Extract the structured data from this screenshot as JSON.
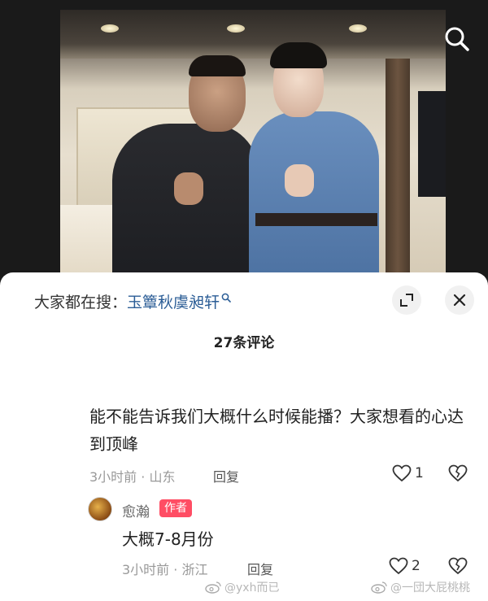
{
  "header": {
    "search_icon": "search-icon"
  },
  "photo": {
    "description_icon": "photo"
  },
  "hot_search": {
    "label": "大家都在搜：",
    "topic": "玉簟秋虞昶轩",
    "icon": "search-small-icon"
  },
  "controls": {
    "expand_icon": "expand-icon",
    "close_icon": "close-icon"
  },
  "comments_header": {
    "count_label": "27条评论"
  },
  "comment": {
    "text": "能不能告诉我们大概什么时候能播？大家想看的心达到顶峰",
    "time_location": "3小时前 · 山东",
    "reply_label": "回复",
    "likes": "1"
  },
  "reply": {
    "author": "愈瀚",
    "badge": "作者",
    "text": "大概7-8月份",
    "time_location": "3小时前 · 浙江",
    "reply_label": "回复",
    "likes": "2"
  },
  "watermarks": [
    "@yxh而已",
    "@一団大屁桃桃"
  ],
  "colors": {
    "accent_link": "#2b5d96",
    "badge": "#ff4d64",
    "meta": "#999999"
  }
}
